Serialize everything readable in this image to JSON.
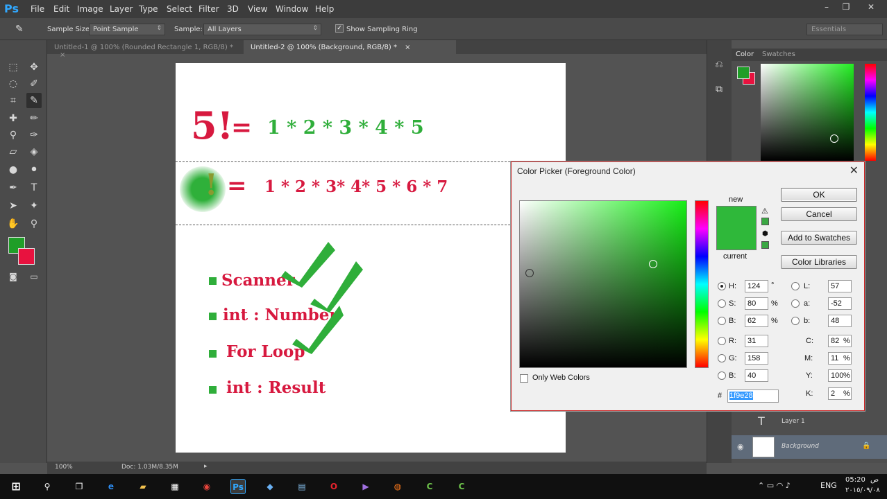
{
  "app": {
    "logo": "Ps",
    "menu": [
      "File",
      "Edit",
      "Image",
      "Layer",
      "Type",
      "Select",
      "Filter",
      "3D",
      "View",
      "Window",
      "Help"
    ]
  },
  "options": {
    "sample_size_label": "Sample Size:",
    "sample_size_value": "Point Sample",
    "sample_label": "Sample:",
    "sample_value": "All Layers",
    "show_ring_label": "Show Sampling Ring",
    "workspace": "Essentials"
  },
  "tabs": [
    {
      "label": "Untitled-1 @ 100% (Rounded Rectangle 1, RGB/8) *"
    },
    {
      "label": "Untitled-2 @ 100% (Background, RGB/8) *"
    }
  ],
  "canvas": {
    "eq1_lhs": "5!",
    "eq1_eq": "=",
    "eq1_rhs": "1 * 2 * 3 * 4 * 5",
    "eq2_excl": "!",
    "eq2_eq": "=",
    "eq2_rhs": "1 * 2 * 3* 4* 5 * 6 * 7",
    "bullets": [
      "Scanner",
      "int : Number",
      "For Loop",
      "int : Result"
    ],
    "colors": {
      "red": "#d7193f",
      "green": "#2fae3a"
    }
  },
  "color_panel": {
    "tabs": [
      "Color",
      "Swatches"
    ]
  },
  "layers": [
    {
      "name": "Layer 1"
    },
    {
      "name": "Background"
    }
  ],
  "status": {
    "zoom": "100%",
    "doc": "Doc: 1.03M/8.35M"
  },
  "dialog": {
    "title": "Color Picker (Foreground Color)",
    "new_label": "new",
    "current_label": "current",
    "ok": "OK",
    "cancel": "Cancel",
    "add_swatches": "Add to Swatches",
    "color_libraries": "Color Libraries",
    "only_web_colors": "Only Web Colors",
    "hsb": {
      "h": "124",
      "s": "80",
      "b": "62",
      "h_unit": "°",
      "s_unit": "%",
      "b_unit": "%"
    },
    "rgb": {
      "r": "31",
      "g": "158",
      "b": "40"
    },
    "lab": {
      "l": "57",
      "a": "-52",
      "b": "48"
    },
    "cmyk": {
      "c": "82",
      "m": "11",
      "y": "100",
      "k": "2",
      "unit": "%"
    },
    "labels": {
      "h": "H:",
      "s": "S:",
      "bb": "B:",
      "r": "R:",
      "g": "G:",
      "b": "B:",
      "l": "L:",
      "a": "a:",
      "lab_b": "b:",
      "c": "C:",
      "m": "M:",
      "y": "Y:",
      "k": "K:",
      "hash": "#"
    },
    "hex": "1f9e28",
    "new_color": "#2fb83a",
    "current_color": "#2fb83a"
  },
  "taskbar": {
    "lang": "ENG",
    "time": "05:20",
    "ampm": "ص",
    "date": "٢٠١٥/٠٩/٠٨"
  }
}
